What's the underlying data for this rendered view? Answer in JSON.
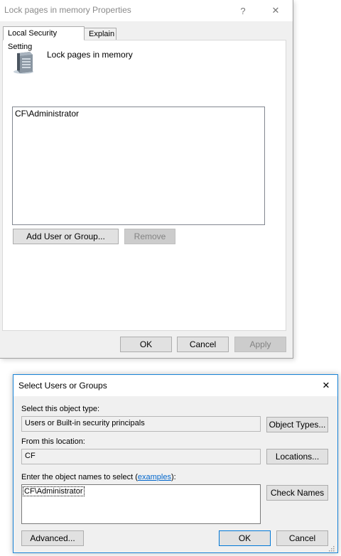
{
  "properties_dialog": {
    "title": "Lock pages in memory Properties",
    "help_glyph": "?",
    "close_glyph": "✕",
    "tabs": [
      {
        "label": "Local Security Setting"
      },
      {
        "label": "Explain"
      }
    ],
    "policy_icon": "server-icon",
    "policy_name": "Lock pages in memory",
    "members": [
      "CF\\Administrator"
    ],
    "add_button": "Add User or Group...",
    "remove_button": "Remove",
    "ok_button": "OK",
    "cancel_button": "Cancel",
    "apply_button": "Apply"
  },
  "select_dialog": {
    "title": "Select Users or Groups",
    "close_glyph": "✕",
    "object_type_label": "Select this object type:",
    "object_type_value": "Users or Built-in security principals",
    "object_types_button": "Object Types...",
    "location_label": "From this location:",
    "location_value": "CF",
    "locations_button": "Locations...",
    "names_label_prefix": "Enter the object names to select (",
    "names_label_link": "examples",
    "names_label_suffix": "):",
    "names_value": "CF\\Administrator",
    "check_names_button": "Check Names",
    "advanced_button": "Advanced...",
    "ok_button": "OK",
    "cancel_button": "Cancel"
  },
  "colors": {
    "dialog_bg": "#f0f0f0",
    "accent": "#0078d7",
    "link": "#0066cc"
  }
}
